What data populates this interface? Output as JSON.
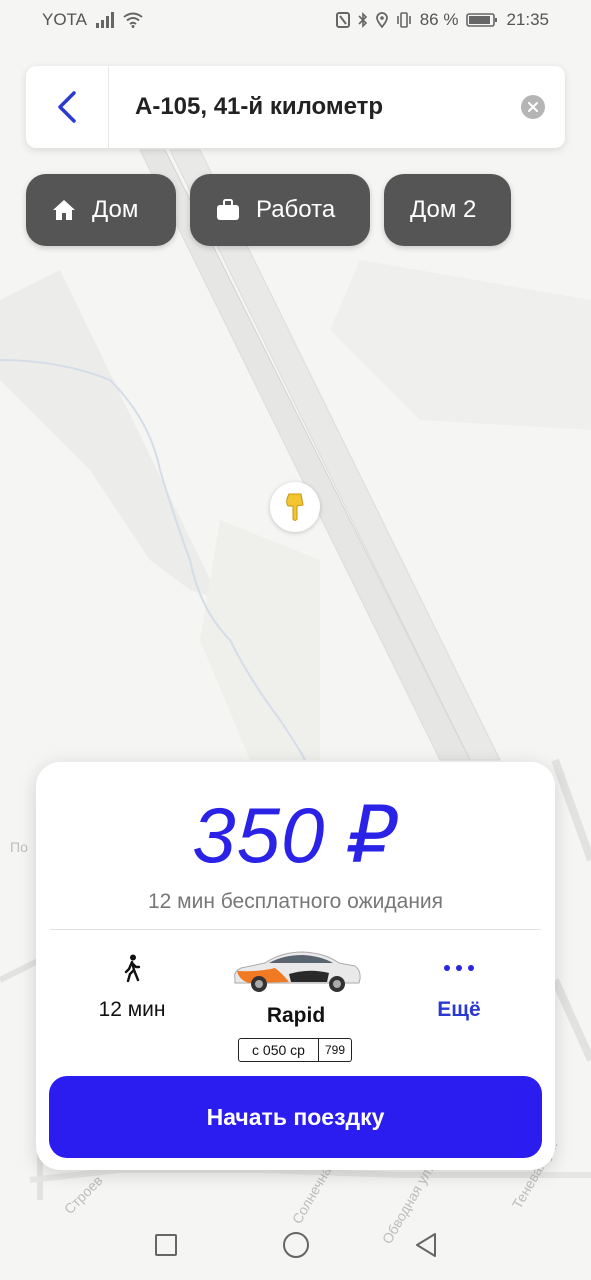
{
  "status_bar": {
    "carrier": "YOTA",
    "battery": "86 %",
    "time": "21:35"
  },
  "search": {
    "value": "А-105, 41-й километр"
  },
  "quick_places": [
    {
      "label": "Дом",
      "icon": "home-icon"
    },
    {
      "label": "Работа",
      "icon": "briefcase-icon"
    },
    {
      "label": "Дом 2",
      "icon": ""
    }
  ],
  "map_labels": {
    "street1": "Строев",
    "street2": "Солнечная",
    "street3": "Обводная ул.",
    "street4": "Теневая ул.",
    "street5": "По"
  },
  "trip": {
    "price": "350 ₽",
    "wait_note": "12 мин бесплатного ожидания",
    "walk_time": "12 мин",
    "car_model": "Rapid",
    "plate_number": "с 050 ср",
    "plate_region": "799",
    "more_label": "Ещё",
    "start_button": "Начать поездку"
  },
  "colors": {
    "accent": "#2b1cf0",
    "price": "#2a22e6",
    "chip_bg": "#555555"
  }
}
